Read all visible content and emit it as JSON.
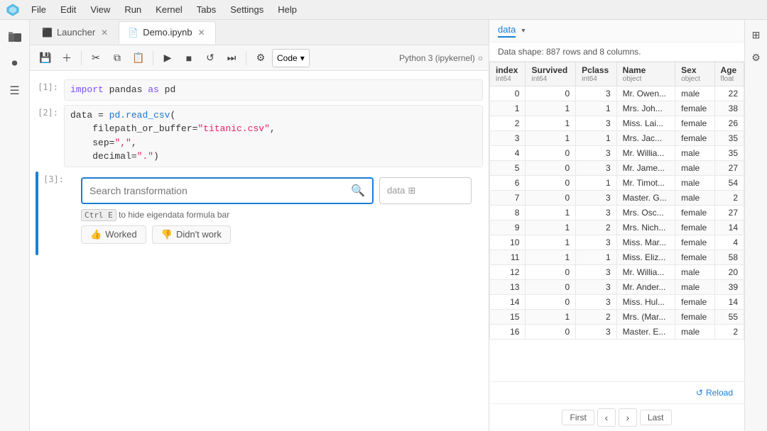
{
  "menubar": {
    "items": [
      "File",
      "Edit",
      "View",
      "Run",
      "Kernel",
      "Tabs",
      "Settings",
      "Help"
    ]
  },
  "tabs": [
    {
      "label": "Launcher",
      "active": false,
      "icon": "⬛"
    },
    {
      "label": "Demo.ipynb",
      "active": true,
      "icon": "📄"
    }
  ],
  "toolbar": {
    "cell_type": "Code",
    "kernel_label": "Python 3 (ipykernel)"
  },
  "cells": [
    {
      "number": "[1]:",
      "code": "import pandas as pd"
    },
    {
      "number": "[2]:",
      "code": "data = pd.read_csv(\n    filepath_or_buffer=\"titanic.csv\",\n    sep=\",\",\n    decimal=\".\")"
    },
    {
      "number": "[3]:",
      "code": ""
    }
  ],
  "transform": {
    "search_placeholder": "Search transformation",
    "data_placeholder": "data",
    "shortcut_hint": "to hide eigendata formula bar",
    "shortcut_key": "Ctrl E",
    "worked_label": "Worked",
    "didnt_work_label": "Didn't work"
  },
  "right_panel": {
    "tab_label": "data",
    "shape_text": "Data shape: 887 rows and 8 columns.",
    "columns": [
      "index",
      "Survived",
      "Pclass",
      "Name",
      "Sex",
      "Age"
    ],
    "dtypes": [
      "int64",
      "int64",
      "int64",
      "object",
      "object",
      "float"
    ],
    "rows": [
      [
        0,
        0,
        3,
        "Mr. Owen...",
        "male",
        22
      ],
      [
        1,
        1,
        1,
        "Mrs. Joh...",
        "female",
        38
      ],
      [
        2,
        1,
        3,
        "Miss. Lai...",
        "female",
        26
      ],
      [
        3,
        1,
        1,
        "Mrs. Jac...",
        "female",
        35
      ],
      [
        4,
        0,
        3,
        "Mr. Willia...",
        "male",
        35
      ],
      [
        5,
        0,
        3,
        "Mr. Jame...",
        "male",
        27
      ],
      [
        6,
        0,
        1,
        "Mr. Timot...",
        "male",
        54
      ],
      [
        7,
        0,
        3,
        "Master. G...",
        "male",
        2
      ],
      [
        8,
        1,
        3,
        "Mrs. Osc...",
        "female",
        27
      ],
      [
        9,
        1,
        2,
        "Mrs. Nich...",
        "female",
        14
      ],
      [
        10,
        1,
        3,
        "Miss. Mar...",
        "female",
        4
      ],
      [
        11,
        1,
        1,
        "Miss. Eliz...",
        "female",
        58
      ],
      [
        12,
        0,
        3,
        "Mr. Willia...",
        "male",
        20
      ],
      [
        13,
        0,
        3,
        "Mr. Ander...",
        "male",
        39
      ],
      [
        14,
        0,
        3,
        "Miss. Hul...",
        "female",
        14
      ],
      [
        15,
        1,
        2,
        "Mrs. (Mar...",
        "female",
        55
      ],
      [
        16,
        0,
        3,
        "Master. E...",
        "male",
        2
      ]
    ],
    "pagination": {
      "first": "First",
      "prev": "‹",
      "next": "›",
      "last": "Last"
    },
    "reload_label": "Reload"
  }
}
